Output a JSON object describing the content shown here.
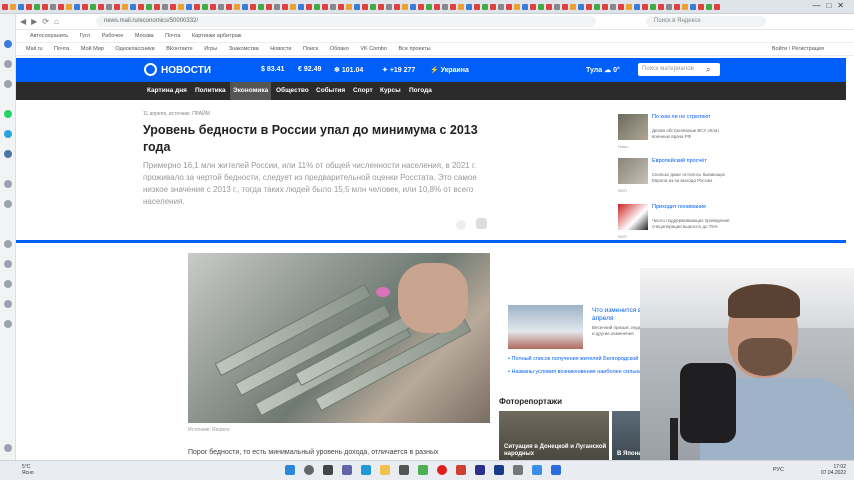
{
  "browser": {
    "url": "news.mail.ru/economics/50000332/",
    "search_placeholder": "Поиск в Яндексе",
    "bookmarks": [
      "Автосохранить",
      "Гугл",
      "Рабочее",
      "Москва",
      "Почта",
      "Картинки арбитраж"
    ]
  },
  "mailbar": {
    "items": [
      "Mail.ru",
      "Почта",
      "Мой Мир",
      "Одноклассники",
      "ВКонтакте",
      "Игры",
      "Знакомства",
      "Новости",
      "Поиск",
      "Облако",
      "VK Combo",
      "Все проекты"
    ],
    "right": "Войти / Регистрация"
  },
  "header": {
    "logo": "НОВОСТИ",
    "rates": [
      {
        "symbol": "$",
        "value": "83.41"
      },
      {
        "symbol": "€",
        "value": "92.49"
      },
      {
        "symbol": "❄",
        "value": "101.04"
      },
      {
        "symbol": "✦",
        "value": "+19 277"
      },
      {
        "symbol": "⚡",
        "value": "Украина"
      }
    ],
    "city": "Тула",
    "temp": "0°",
    "search_placeholder": "Поиск материалов"
  },
  "menu": [
    "Картина дня",
    "Политика",
    "Экономика",
    "Общество",
    "События",
    "Спорт",
    "Курсы",
    "Погода"
  ],
  "article": {
    "meta": "11 апреля, источник: ПРАЙМ",
    "title": "Уровень бедности в России упал до минимума с 2013 года",
    "lead": "Примерно 16,1 млн жителей России, или 11% от общей численности населения, в 2021 г. проживало за чертой бедности, следует из предварительной оценки Росстата. Это самое низкое значение с 2013 г., тогда таких людей было 15,5 млн человек, или 10,8% от всего населения.",
    "photo_caption": "Источник: Reuters",
    "body_start": "Порог бедности, то есть минимальный уровень дохода, отличается в разных"
  },
  "right_news": [
    {
      "headline": "По ком ли не стреляют",
      "desc": "Делая обстрелянные ВСУ сёлат военные врача РФ",
      "source": "Нова..."
    },
    {
      "headline": "Европейский просчёт",
      "desc": "Сколько даже осталось бывающих Европа из-за выхода России",
      "source": "ФИП"
    },
    {
      "headline": "Приходит понимание",
      "desc": "Число поддерживающих проведение спецоперации выросло до 75%",
      "source": "ФИП"
    }
  ],
  "big_news": {
    "headline": "Что изменится в жизни россиян с 1 апреля",
    "desc": "Весенний призыв, индексация пенсий, налоговые льготы и другие изменения",
    "links": [
      "Полный список получения жителей Белгородской области",
      "Названы условия возникновения наиболее сильных эпизод"
    ]
  },
  "fotos": {
    "title": "Фоторепортажи",
    "items": [
      "Ситуация в Донецкой и Луганской народных",
      "В Японии праздники"
    ]
  },
  "taskbar": {
    "weather_temp": "5°C",
    "weather_desc": "Ясно",
    "lang": "РУС",
    "time": "17:02",
    "date": "07.04.2022"
  }
}
